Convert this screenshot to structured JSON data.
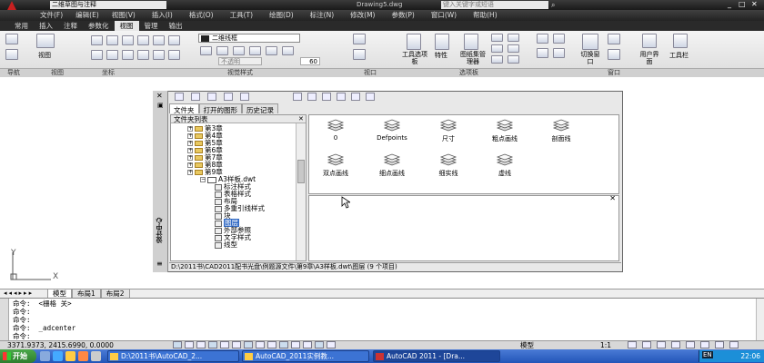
{
  "title_bar": {
    "workspace": "二维草图与注释",
    "filename": "Drawing5.dwg",
    "search_placeholder": "键入关键字或短语"
  },
  "menu": [
    "文件(F)",
    "编辑(E)",
    "视图(V)",
    "插入(I)",
    "格式(O)",
    "工具(T)",
    "绘图(D)",
    "标注(N)",
    "修改(M)",
    "参数(P)",
    "窗口(W)",
    "帮助(H)"
  ],
  "ribbon_tabs": [
    "常用",
    "插入",
    "注释",
    "参数化",
    "视图",
    "管理",
    "输出"
  ],
  "ribbon": {
    "layer_combo": "二维线框",
    "combo_value": "60",
    "btn_view": "视图",
    "btn_tool_palette": "工具选项板",
    "btn_properties": "特性",
    "btn_sheet_set": "图纸集管理器",
    "btn_switch_window": "切换窗口",
    "btn_user_interface": "用户界面",
    "btn_toolbars": "工具栏",
    "btn_dropdown": "不透明",
    "group_labels": [
      "导航",
      "视图",
      "坐标",
      "视觉样式",
      "视口",
      "选项板",
      "窗口"
    ]
  },
  "design_center": {
    "side_label": "设计中心",
    "tabs": [
      "文件夹",
      "打开的图形",
      "历史记录"
    ],
    "tree_header": "文件夹列表",
    "tree": [
      {
        "label": "第3章",
        "type": "folder"
      },
      {
        "label": "第4章",
        "type": "folder"
      },
      {
        "label": "第5章",
        "type": "folder"
      },
      {
        "label": "第6章",
        "type": "folder"
      },
      {
        "label": "第7章",
        "type": "folder"
      },
      {
        "label": "第8章",
        "type": "folder"
      },
      {
        "label": "第9章",
        "type": "folder"
      },
      {
        "label": "A3样板.dwt",
        "type": "dwt"
      },
      {
        "label": "标注样式",
        "type": "item"
      },
      {
        "label": "表格样式",
        "type": "item"
      },
      {
        "label": "布局",
        "type": "item"
      },
      {
        "label": "多重引线样式",
        "type": "item"
      },
      {
        "label": "块",
        "type": "item"
      },
      {
        "label": "图层",
        "type": "item",
        "selected": true
      },
      {
        "label": "外部参照",
        "type": "item"
      },
      {
        "label": "文字样式",
        "type": "item"
      },
      {
        "label": "线型",
        "type": "item"
      }
    ],
    "layers": [
      "0",
      "Defpoints",
      "尺寸",
      "粗点画线",
      "剖面线",
      "双点画线",
      "细点画线",
      "细实线",
      "虚线"
    ],
    "path": "D:\\2011书\\CAD2011配书光盘\\例题源文件\\第9章\\A3样板.dwt\\图层  (9 个项目)"
  },
  "layout_tabs": [
    "模型",
    "布局1",
    "布局2"
  ],
  "command_lines": [
    "命令:  <栅格 关>",
    "命令:",
    "命令:",
    "命令:  _adcenter",
    "命令:"
  ],
  "status": {
    "coords": "3371.9373,  2415.6990,  0.0000",
    "model_label": "模型",
    "scale": "1:1"
  },
  "taskbar": {
    "start": "开始",
    "items": [
      "D:\\2011书\\AutoCAD_2...",
      "AutoCAD_2011实例教...",
      "AutoCAD 2011 - [Dra..."
    ],
    "lang": "EN",
    "clock": "22:06"
  },
  "ucs": {
    "y": "Y",
    "x": "X"
  }
}
